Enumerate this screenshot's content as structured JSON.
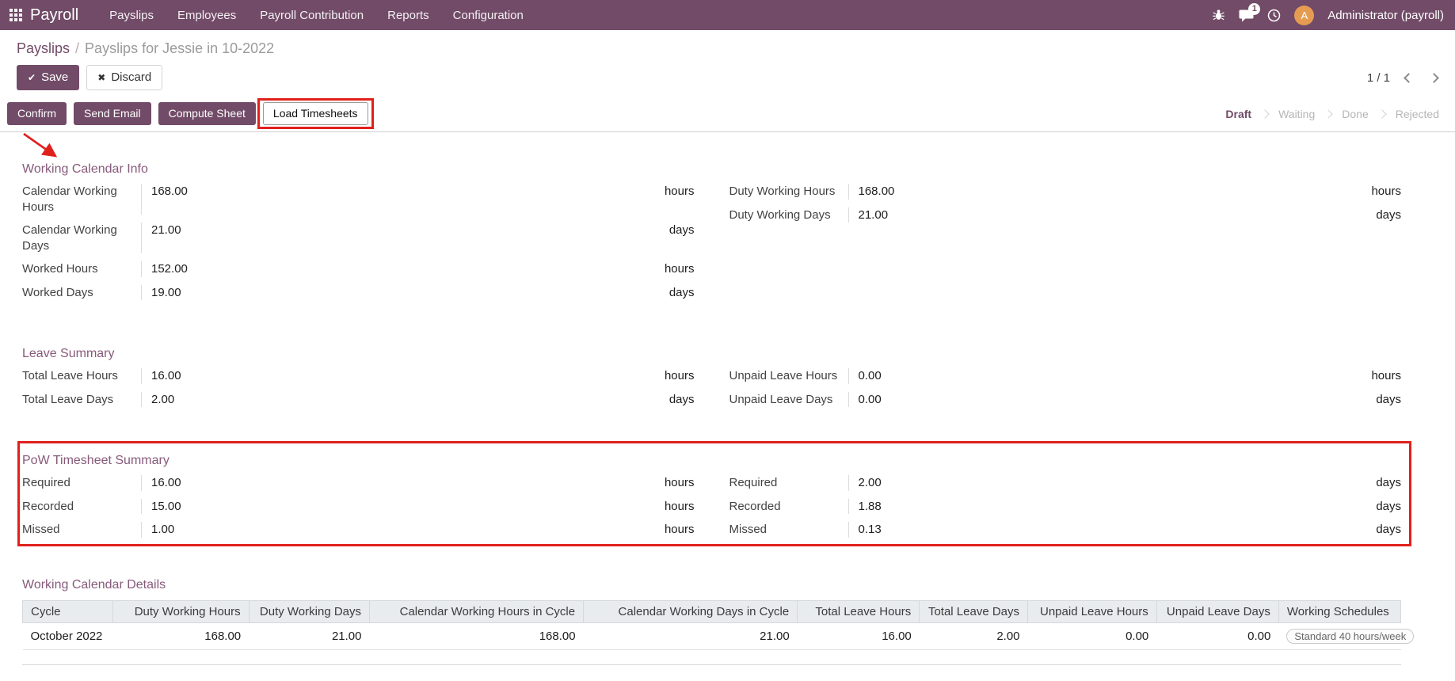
{
  "colors": {
    "accent": "#714B67",
    "section_title": "#875A7B",
    "annotation_red": "#e0201c",
    "avatar_orange": "#E59C52"
  },
  "nav": {
    "brand": "Payroll",
    "items": [
      "Payslips",
      "Employees",
      "Payroll Contribution",
      "Reports",
      "Configuration"
    ],
    "message_badge": "1",
    "avatar_letter": "A",
    "user_name": "Administrator (payroll)"
  },
  "breadcrumb": {
    "parent": "Payslips",
    "separator": "/",
    "current": "Payslips for Jessie in 10-2022"
  },
  "toolbar": {
    "save_icon": "✔",
    "save_label": "Save",
    "discard_icon": "✖",
    "discard_label": "Discard",
    "pager": "1 / 1"
  },
  "statusbar": {
    "buttons": {
      "confirm": "Confirm",
      "send_email": "Send Email",
      "compute_sheet": "Compute Sheet",
      "load_timesheets": "Load Timesheets"
    },
    "states": {
      "draft": "Draft",
      "waiting": "Waiting",
      "done": "Done",
      "rejected": "Rejected"
    }
  },
  "working_calendar_info": {
    "title": "Working Calendar Info",
    "rows_left": [
      {
        "label": "Calendar Working Hours",
        "value": "168.00",
        "unit": "hours"
      },
      {
        "label": "Calendar Working Days",
        "value": "21.00",
        "unit": "days"
      },
      {
        "label": "Worked Hours",
        "value": "152.00",
        "unit": "hours"
      },
      {
        "label": "Worked Days",
        "value": "19.00",
        "unit": "days"
      }
    ],
    "rows_right": [
      {
        "label": "Duty Working Hours",
        "value": "168.00",
        "unit": "hours"
      },
      {
        "label": "Duty Working Days",
        "value": "21.00",
        "unit": "days"
      }
    ]
  },
  "leave_summary": {
    "title": "Leave Summary",
    "rows_left": [
      {
        "label": "Total Leave Hours",
        "value": "16.00",
        "unit": "hours"
      },
      {
        "label": "Total Leave Days",
        "value": "2.00",
        "unit": "days"
      }
    ],
    "rows_right": [
      {
        "label": "Unpaid Leave Hours",
        "value": "0.00",
        "unit": "hours"
      },
      {
        "label": "Unpaid Leave Days",
        "value": "0.00",
        "unit": "days"
      }
    ]
  },
  "pow_timesheet_summary": {
    "title": "PoW Timesheet Summary",
    "rows_left": [
      {
        "label": "Required",
        "value": "16.00",
        "unit": "hours"
      },
      {
        "label": "Recorded",
        "value": "15.00",
        "unit": "hours"
      },
      {
        "label": "Missed",
        "value": "1.00",
        "unit": "hours"
      }
    ],
    "rows_right": [
      {
        "label": "Required",
        "value": "2.00",
        "unit": "days"
      },
      {
        "label": "Recorded",
        "value": "1.88",
        "unit": "days"
      },
      {
        "label": "Missed",
        "value": "0.13",
        "unit": "days"
      }
    ]
  },
  "working_calendar_details": {
    "title": "Working Calendar Details",
    "headers": [
      "Cycle",
      "Duty Working Hours",
      "Duty Working Days",
      "Calendar Working Hours in Cycle",
      "Calendar Working Days in Cycle",
      "Total Leave Hours",
      "Total Leave Days",
      "Unpaid Leave Hours",
      "Unpaid Leave Days",
      "Working Schedules"
    ],
    "row": {
      "cycle": "October 2022",
      "duty_working_hours": "168.00",
      "duty_working_days": "21.00",
      "calendar_working_hours_in_cycle": "168.00",
      "calendar_working_days_in_cycle": "21.00",
      "total_leave_hours": "16.00",
      "total_leave_days": "2.00",
      "unpaid_leave_hours": "0.00",
      "unpaid_leave_days": "0.00",
      "working_schedule": "Standard 40 hours/week"
    }
  }
}
